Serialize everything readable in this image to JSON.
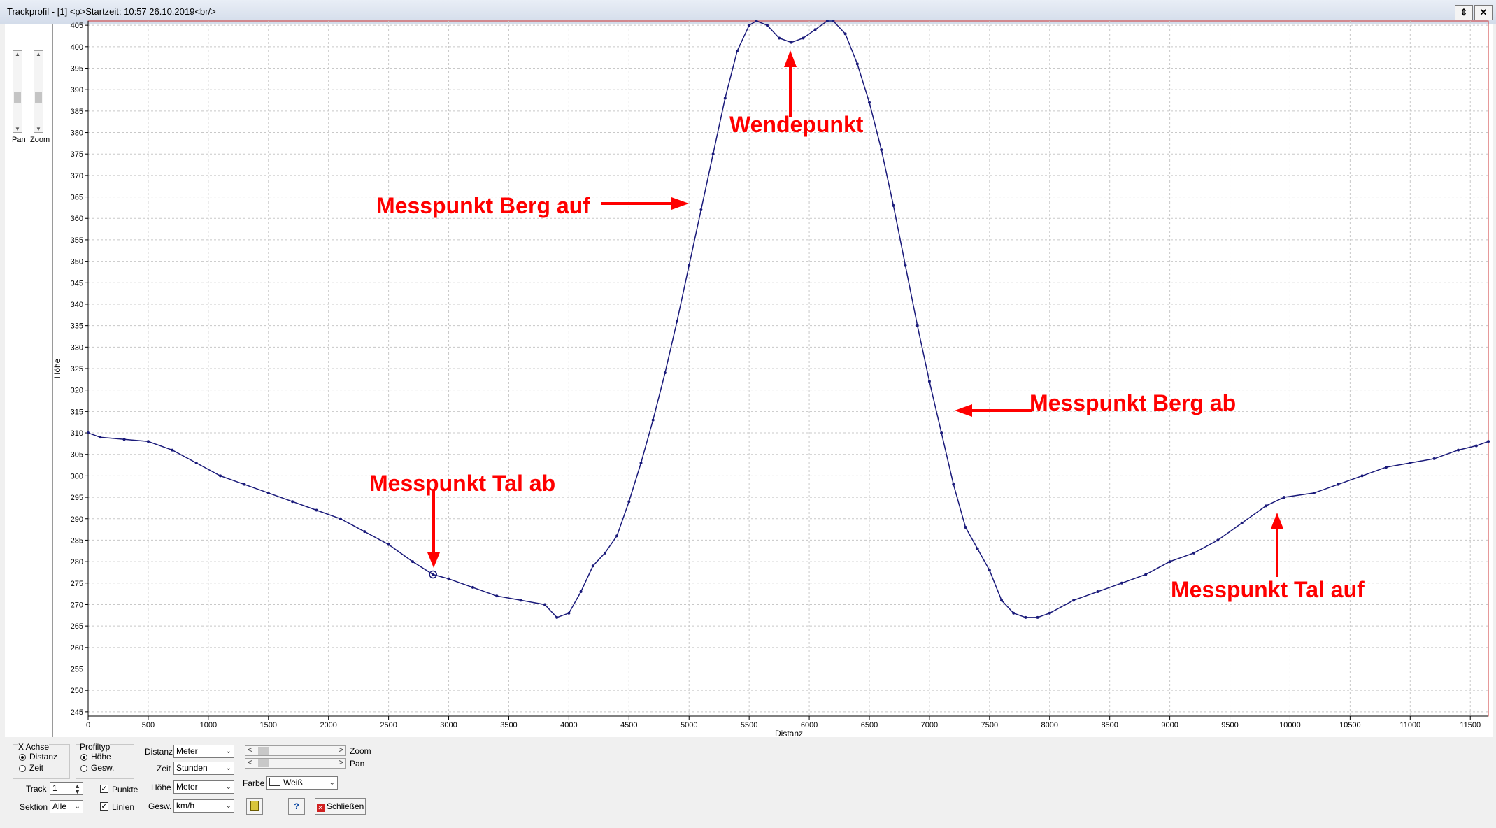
{
  "window": {
    "title": "Trackprofil - [1] <p>Startzeit: 10:57 26.10.2019<br/>",
    "restore_glyph": "⇕",
    "close_glyph": "✕"
  },
  "side": {
    "pan_label": "Pan",
    "zoom_label": "Zoom"
  },
  "chart_data": {
    "type": "line",
    "xlabel": "Distanz",
    "ylabel": "Höhe",
    "xlim": [
      0,
      11650
    ],
    "ylim": [
      244,
      406
    ],
    "x_ticks": [
      0,
      500,
      1000,
      1500,
      2000,
      2500,
      3000,
      3500,
      4000,
      4500,
      5000,
      5500,
      6000,
      6500,
      7000,
      7500,
      8000,
      8500,
      9000,
      9500,
      10000,
      10500,
      11000,
      11500
    ],
    "y_ticks": [
      245,
      250,
      255,
      260,
      265,
      270,
      275,
      280,
      285,
      290,
      295,
      300,
      305,
      310,
      315,
      320,
      325,
      330,
      335,
      340,
      345,
      350,
      355,
      360,
      365,
      370,
      375,
      380,
      385,
      390,
      395,
      400,
      405
    ],
    "grid": true,
    "line_color": "#1a1a7a",
    "series": [
      {
        "x": [
          0,
          100,
          300,
          500,
          700,
          900,
          1100,
          1300,
          1500,
          1700,
          1900,
          2100,
          2300,
          2500,
          2700,
          2870,
          3000,
          3200,
          3400,
          3600,
          3800,
          3900,
          4000,
          4100,
          4200,
          4300,
          4400,
          4500,
          4600,
          4700,
          4800,
          4900,
          5000,
          5100,
          5200,
          5300,
          5400,
          5500,
          5560,
          5650,
          5750,
          5850,
          5950,
          6050,
          6150,
          6200,
          6300,
          6400,
          6500,
          6600,
          6700,
          6800,
          6900,
          7000,
          7100,
          7200,
          7300,
          7400,
          7500,
          7600,
          7700,
          7800,
          7900,
          8000,
          8200,
          8400,
          8600,
          8800,
          9000,
          9200,
          9400,
          9600,
          9800,
          9950,
          10200,
          10400,
          10600,
          10800,
          11000,
          11200,
          11400,
          11550,
          11650
        ],
        "y": [
          310,
          309,
          308.5,
          308,
          306,
          303,
          300,
          298,
          296,
          294,
          292,
          290,
          287,
          284,
          280,
          277,
          276,
          274,
          272,
          271,
          270,
          267,
          268,
          273,
          279,
          282,
          286,
          294,
          303,
          313,
          324,
          336,
          349,
          362,
          375,
          388,
          399,
          405,
          406,
          405,
          402,
          401,
          402,
          404,
          406,
          406,
          403,
          396,
          387,
          376,
          363,
          349,
          335,
          322,
          310,
          298,
          288,
          283,
          278,
          271,
          268,
          267,
          267,
          268,
          271,
          273,
          275,
          277,
          280,
          282,
          285,
          289,
          293,
          295,
          296,
          298,
          300,
          302,
          303,
          304,
          306,
          307,
          308
        ]
      }
    ],
    "marker_x": 2870,
    "marker_y": 277
  },
  "annotations": {
    "color": "#ff0000",
    "wendepunkt": "Wendepunkt",
    "berg_auf": "Messpunkt Berg auf",
    "berg_ab": "Messpunkt Berg ab",
    "tal_ab": "Messpunkt Tal ab",
    "tal_auf": "Messpunkt Tal auf"
  },
  "controls": {
    "xachse_title": "X Achse",
    "xachse_opt1": "Distanz",
    "xachse_opt2": "Zeit",
    "profiltyp_title": "Profiltyp",
    "profiltyp_opt1": "Höhe",
    "profiltyp_opt2": "Gesw.",
    "distanz_label": "Distanz",
    "distanz_value": "Meter",
    "zeit_label": "Zeit",
    "zeit_value": "Stunden",
    "hoehe_label": "Höhe",
    "hoehe_value": "Meter",
    "gesw_label": "Gesw.",
    "gesw_value": "km/h",
    "zoom_label": "Zoom",
    "pan_label": "Pan",
    "farbe_label": "Farbe",
    "farbe_value": "Weiß",
    "track_label": "Track",
    "track_value": "1",
    "sektion_label": "Sektion",
    "sektion_value": "Alle",
    "punkte_label": "Punkte",
    "linien_label": "Linien",
    "close_label": "Schließen",
    "help_glyph": "?",
    "arrow_left": "<",
    "arrow_right": ">",
    "dropdown_glyph": "⌄",
    "check_glyph": "✓"
  }
}
